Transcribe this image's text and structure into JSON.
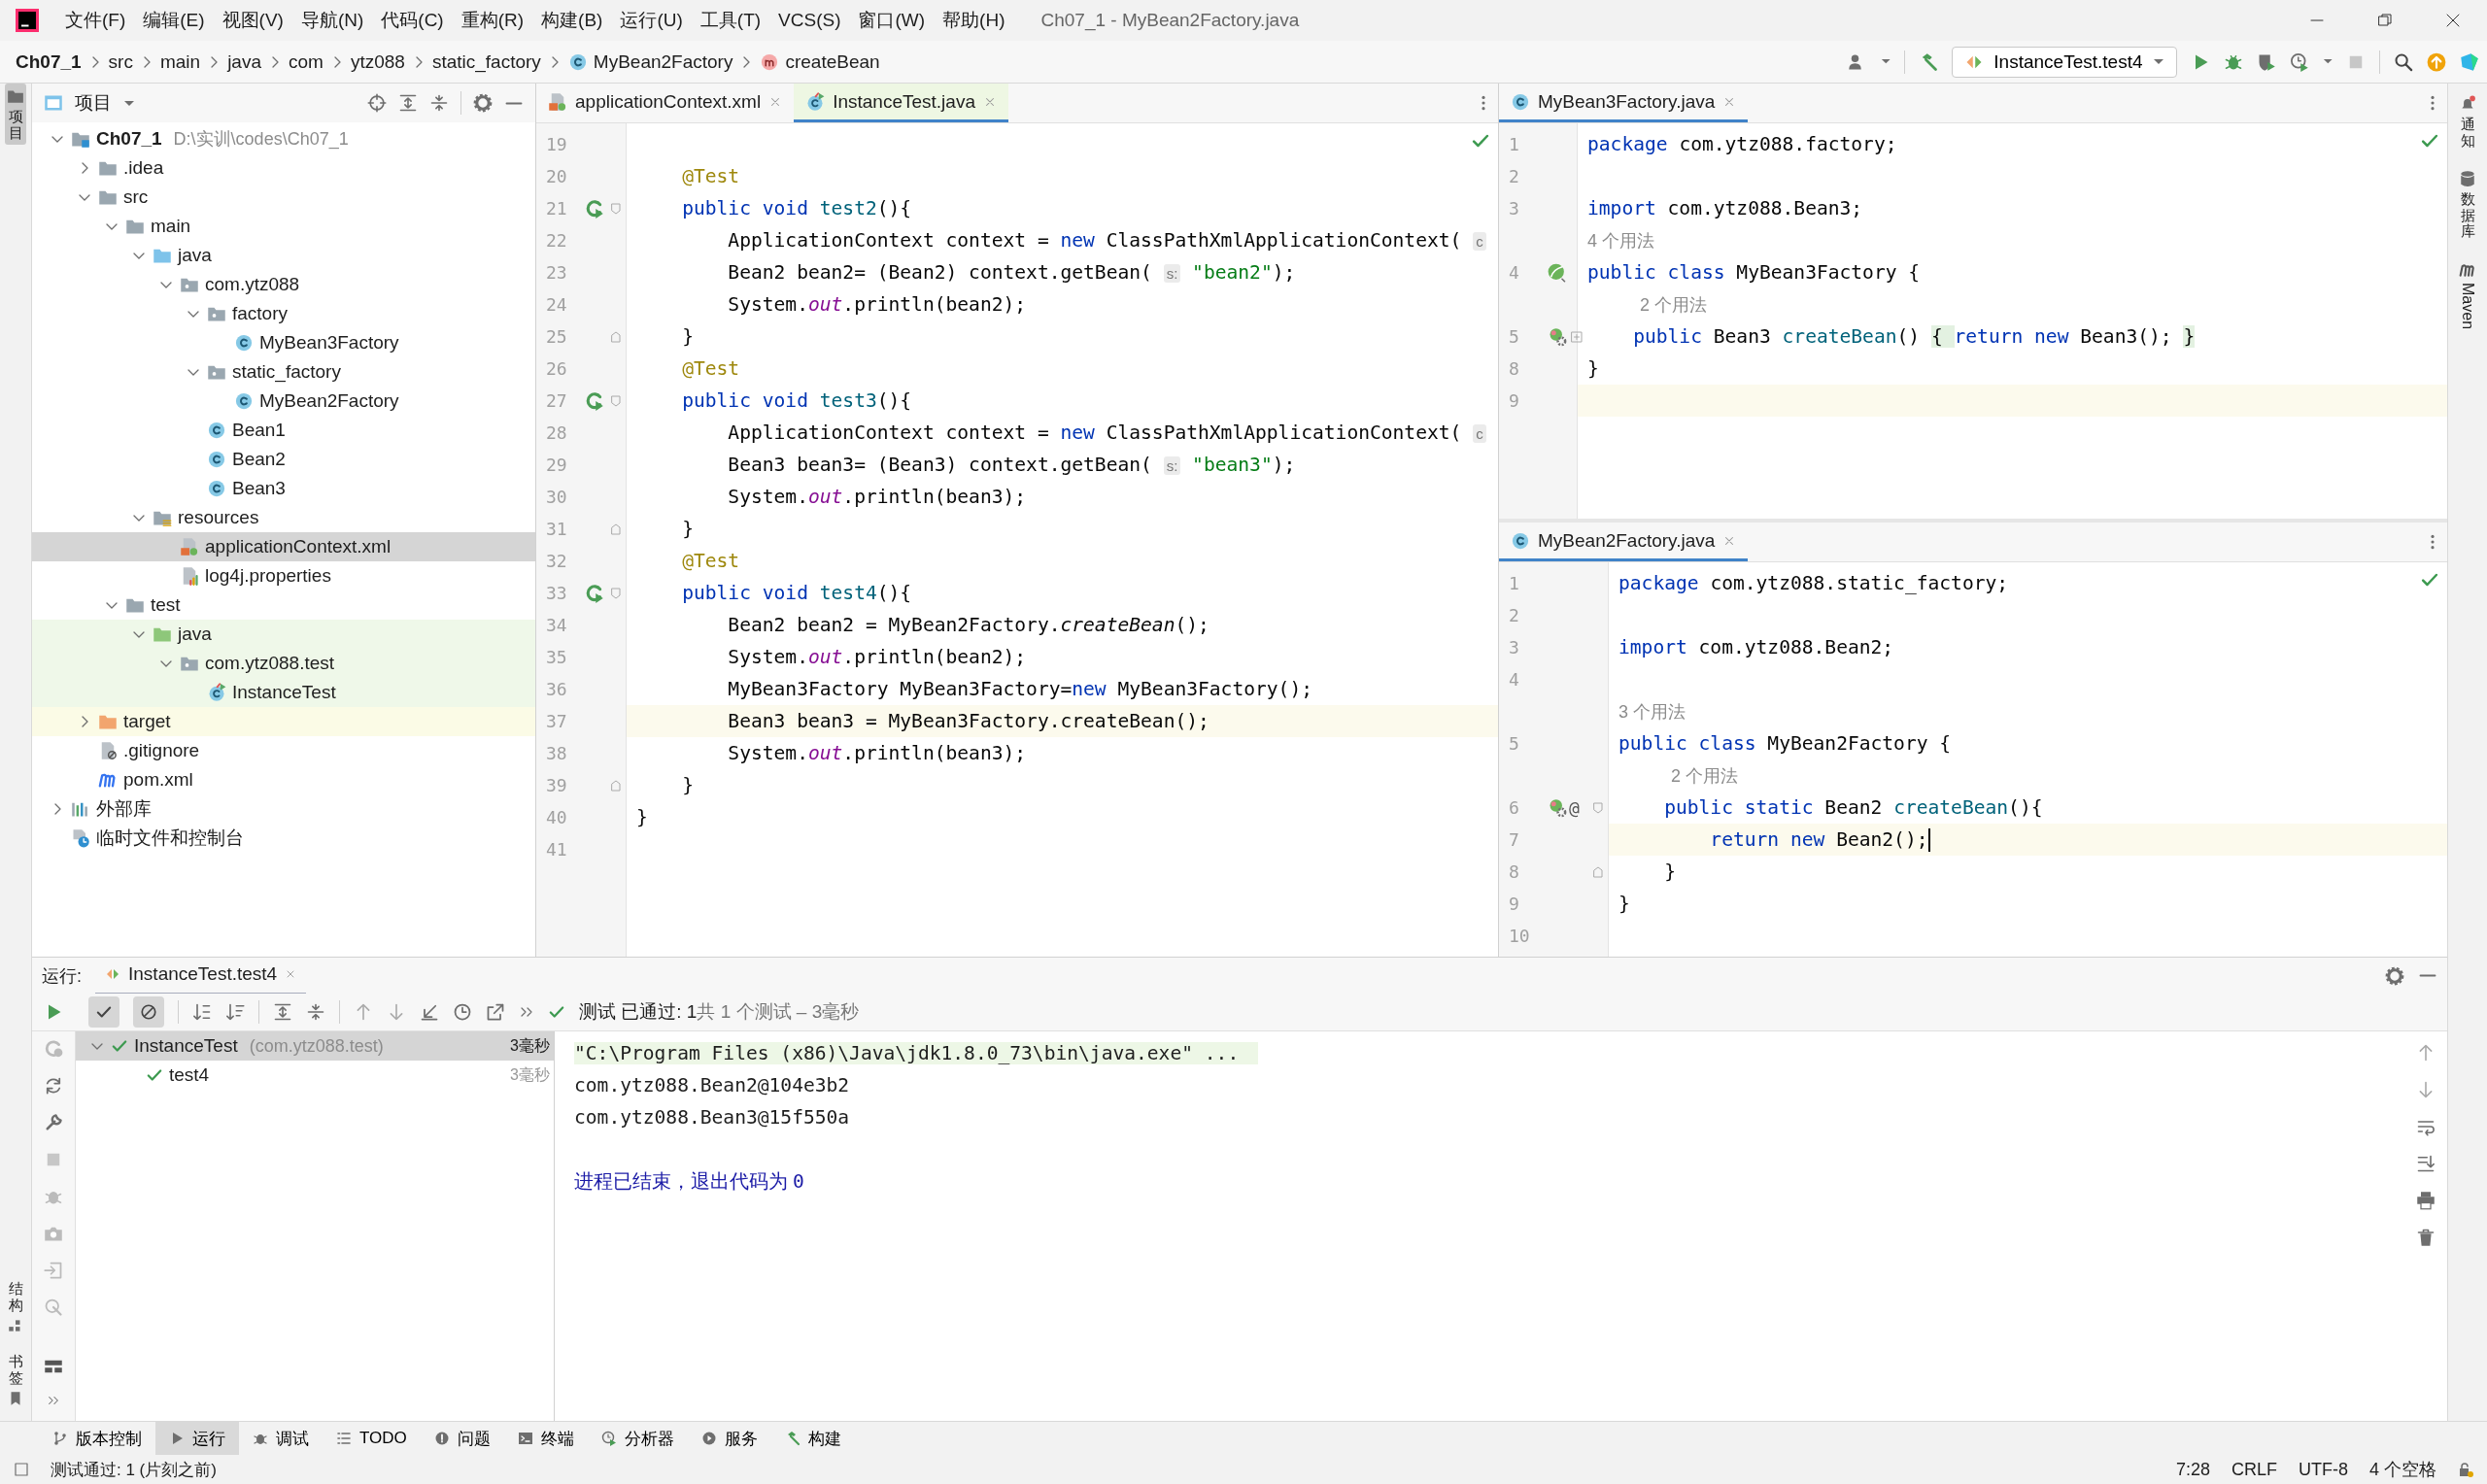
{
  "window": {
    "title": "Ch07_1 - MyBean2Factory.java"
  },
  "menu": [
    "文件(F)",
    "编辑(E)",
    "视图(V)",
    "导航(N)",
    "代码(C)",
    "重构(R)",
    "构建(B)",
    "运行(U)",
    "工具(T)",
    "VCS(S)",
    "窗口(W)",
    "帮助(H)"
  ],
  "breadcrumbs": [
    {
      "label": "Ch07_1",
      "kind": "project"
    },
    {
      "label": "src",
      "kind": "folder"
    },
    {
      "label": "main",
      "kind": "folder"
    },
    {
      "label": "java",
      "kind": "folder"
    },
    {
      "label": "com",
      "kind": "folder"
    },
    {
      "label": "ytz088",
      "kind": "folder"
    },
    {
      "label": "static_factory",
      "kind": "folder"
    },
    {
      "label": "MyBean2Factory",
      "kind": "class"
    },
    {
      "label": "createBean",
      "kind": "method"
    }
  ],
  "run_config": "InstanceTest.test4",
  "left_strip": {
    "top": [
      {
        "label": "项目",
        "selected": true
      }
    ],
    "bottom": [
      {
        "label": "结构",
        "selected": false
      },
      {
        "label": "书签",
        "selected": false
      }
    ]
  },
  "right_strip": [
    {
      "label": "通知",
      "kind": "notify"
    },
    {
      "label": "数据库",
      "kind": "database"
    },
    {
      "label": "Maven",
      "kind": "maven"
    }
  ],
  "project": {
    "title": "项目",
    "tree": [
      {
        "label": "Ch07_1",
        "hint": "D:\\实训\\codes\\Ch07_1",
        "kind": "project",
        "expanded": true,
        "selected": false,
        "children": [
          {
            "label": ".idea",
            "kind": "folder",
            "expanded": false,
            "selected": false
          },
          {
            "label": "src",
            "kind": "folder",
            "expanded": true,
            "selected": false,
            "children": [
              {
                "label": "main",
                "kind": "folder",
                "expanded": true,
                "selected": false,
                "children": [
                  {
                    "label": "java",
                    "kind": "source-root",
                    "expanded": true,
                    "selected": false,
                    "children": [
                      {
                        "label": "com.ytz088",
                        "kind": "package",
                        "expanded": true,
                        "selected": false,
                        "children": [
                          {
                            "label": "factory",
                            "kind": "package",
                            "expanded": true,
                            "selected": false,
                            "children": [
                              {
                                "label": "MyBean3Factory",
                                "kind": "class",
                                "selected": false
                              }
                            ]
                          },
                          {
                            "label": "static_factory",
                            "kind": "package",
                            "expanded": true,
                            "selected": false,
                            "children": [
                              {
                                "label": "MyBean2Factory",
                                "kind": "class",
                                "selected": false
                              }
                            ]
                          },
                          {
                            "label": "Bean1",
                            "kind": "class",
                            "selected": false
                          },
                          {
                            "label": "Bean2",
                            "kind": "class",
                            "selected": false
                          },
                          {
                            "label": "Bean3",
                            "kind": "class",
                            "selected": false
                          }
                        ]
                      }
                    ]
                  },
                  {
                    "label": "resources",
                    "kind": "resources-root",
                    "expanded": true,
                    "selected": false,
                    "children": [
                      {
                        "label": "applicationContext.xml",
                        "kind": "xml",
                        "selected": true
                      },
                      {
                        "label": "log4j.properties",
                        "kind": "properties",
                        "selected": false
                      }
                    ]
                  }
                ]
              },
              {
                "label": "test",
                "kind": "folder",
                "expanded": true,
                "selected": false,
                "children": [
                  {
                    "label": "java",
                    "kind": "test-root",
                    "test_source": true,
                    "expanded": true,
                    "selected": false,
                    "children": [
                      {
                        "label": "com.ytz088.test",
                        "kind": "package",
                        "test_source": true,
                        "expanded": true,
                        "selected": false,
                        "children": [
                          {
                            "label": "InstanceTest",
                            "kind": "test-class",
                            "test_source": true,
                            "selected": false
                          }
                        ]
                      }
                    ]
                  }
                ]
              }
            ]
          },
          {
            "label": "target",
            "kind": "excluded-folder",
            "excluded": true,
            "expanded": false,
            "selected": false
          },
          {
            "label": ".gitignore",
            "kind": "gitignore",
            "selected": false
          },
          {
            "label": "pom.xml",
            "kind": "maven",
            "selected": false
          }
        ]
      },
      {
        "label": "外部库",
        "kind": "libraries",
        "expanded": false,
        "selected": false
      },
      {
        "label": "临时文件和控制台",
        "kind": "scratches",
        "selected": false
      }
    ]
  },
  "editors": [
    {
      "tabs": [
        {
          "label": "applicationContext.xml",
          "kind": "xml",
          "selected": false
        },
        {
          "label": "InstanceTest.java",
          "kind": "test",
          "selected": true
        }
      ],
      "lines": [
        {
          "num": "19"
        },
        {
          "num": "20",
          "tokens": [
            {
              "kind": "ann",
              "text": "    @Test"
            }
          ]
        },
        {
          "num": "21",
          "gutter": [
            {
              "kind": "run"
            }
          ],
          "fold": {
            "kind": "start"
          },
          "tokens": [
            {
              "kind": "kw",
              "text": "    public void "
            },
            {
              "kind": "fn",
              "text": "test2"
            },
            {
              "kind": "plain",
              "text": "(){"
            }
          ]
        },
        {
          "num": "22",
          "tokens": [
            {
              "kind": "plain",
              "text": "        ApplicationContext context = "
            },
            {
              "kind": "kw",
              "text": "new "
            },
            {
              "kind": "plain",
              "text": "ClassPathXmlApplicationContext( "
            },
            {
              "kind": "hint",
              "text": "c"
            }
          ]
        },
        {
          "num": "23",
          "tokens": [
            {
              "kind": "plain",
              "text": "        Bean2 bean2= (Bean2) context.getBean( "
            },
            {
              "kind": "hint",
              "text": "s:"
            },
            {
              "kind": "str",
              "text": " \"bean2\""
            },
            {
              "kind": "plain",
              "text": ");"
            }
          ]
        },
        {
          "num": "24",
          "tokens": [
            {
              "kind": "plain",
              "text": "        System."
            },
            {
              "kind": "field",
              "text": "out"
            },
            {
              "kind": "plain",
              "text": ".println(bean2);"
            }
          ]
        },
        {
          "num": "25",
          "fold": {
            "kind": "end"
          },
          "tokens": [
            {
              "kind": "plain",
              "text": "    }"
            }
          ]
        },
        {
          "num": "26",
          "tokens": [
            {
              "kind": "ann",
              "text": "    @Test"
            }
          ]
        },
        {
          "num": "27",
          "gutter": [
            {
              "kind": "run"
            }
          ],
          "fold": {
            "kind": "start"
          },
          "tokens": [
            {
              "kind": "kw",
              "text": "    public void "
            },
            {
              "kind": "fn",
              "text": "test3"
            },
            {
              "kind": "plain",
              "text": "(){"
            }
          ]
        },
        {
          "num": "28",
          "tokens": [
            {
              "kind": "plain",
              "text": "        ApplicationContext context = "
            },
            {
              "kind": "kw",
              "text": "new "
            },
            {
              "kind": "plain",
              "text": "ClassPathXmlApplicationContext( "
            },
            {
              "kind": "hint",
              "text": "c"
            }
          ]
        },
        {
          "num": "29",
          "tokens": [
            {
              "kind": "plain",
              "text": "        Bean3 bean3= (Bean3) context.getBean( "
            },
            {
              "kind": "hint",
              "text": "s:"
            },
            {
              "kind": "str",
              "text": " \"bean3\""
            },
            {
              "kind": "plain",
              "text": ");"
            }
          ]
        },
        {
          "num": "30",
          "tokens": [
            {
              "kind": "plain",
              "text": "        System."
            },
            {
              "kind": "field",
              "text": "out"
            },
            {
              "kind": "plain",
              "text": ".println(bean3);"
            }
          ]
        },
        {
          "num": "31",
          "fold": {
            "kind": "end"
          },
          "tokens": [
            {
              "kind": "plain",
              "text": "    }"
            }
          ]
        },
        {
          "num": "32",
          "tokens": [
            {
              "kind": "ann",
              "text": "    @Test"
            }
          ]
        },
        {
          "num": "33",
          "gutter": [
            {
              "kind": "run"
            }
          ],
          "fold": {
            "kind": "start"
          },
          "tokens": [
            {
              "kind": "kw",
              "text": "    public void "
            },
            {
              "kind": "fn",
              "text": "test4"
            },
            {
              "kind": "plain",
              "text": "(){"
            }
          ]
        },
        {
          "num": "34",
          "tokens": [
            {
              "kind": "plain",
              "text": "        Bean2 bean2 = MyBean2Factory."
            },
            {
              "kind": "static",
              "text": "createBean"
            },
            {
              "kind": "plain",
              "text": "();"
            }
          ]
        },
        {
          "num": "35",
          "tokens": [
            {
              "kind": "plain",
              "text": "        System."
            },
            {
              "kind": "field",
              "text": "out"
            },
            {
              "kind": "plain",
              "text": ".println(bean2);"
            }
          ]
        },
        {
          "num": "36",
          "tokens": [
            {
              "kind": "plain",
              "text": "        MyBean3Factory MyBean3Factory="
            },
            {
              "kind": "kw",
              "text": "new "
            },
            {
              "kind": "plain",
              "text": "MyBean3Factory();"
            }
          ]
        },
        {
          "num": "37",
          "current": true,
          "tokens": [
            {
              "kind": "plain",
              "text": "        Bean3 bean3 = MyBean3Factory.createBean();"
            }
          ]
        },
        {
          "num": "38",
          "tokens": [
            {
              "kind": "plain",
              "text": "        System."
            },
            {
              "kind": "field",
              "text": "out"
            },
            {
              "kind": "plain",
              "text": ".println(bean3);"
            }
          ]
        },
        {
          "num": "39",
          "fold": {
            "kind": "end"
          },
          "tokens": [
            {
              "kind": "plain",
              "text": "    }"
            }
          ]
        },
        {
          "num": "40",
          "tokens": [
            {
              "kind": "plain",
              "text": "}"
            }
          ]
        },
        {
          "num": "41"
        }
      ]
    },
    {
      "tabs": [
        {
          "label": "MyBean3Factory.java",
          "kind": "class",
          "selected": true
        }
      ],
      "lines": [
        {
          "num": "1",
          "tokens": [
            {
              "kind": "kw",
              "text": "package "
            },
            {
              "kind": "plain",
              "text": "com.ytz088.factory;"
            }
          ]
        },
        {
          "num": "2"
        },
        {
          "num": "3",
          "tokens": [
            {
              "kind": "kw",
              "text": "import "
            },
            {
              "kind": "plain",
              "text": "com.ytz088.Bean3;"
            }
          ]
        },
        {
          "tokens": [
            {
              "kind": "usage",
              "text": "4 个用法"
            }
          ]
        },
        {
          "num": "4",
          "gutter": [
            {
              "kind": "bean"
            }
          ],
          "tokens": [
            {
              "kind": "kw",
              "text": "public class "
            },
            {
              "kind": "plain",
              "text": "MyBean3Factory {"
            }
          ]
        },
        {
          "tokens": [
            {
              "kind": "usage-indented",
              "text": "2 个用法"
            }
          ]
        },
        {
          "num": "5",
          "gutter": [
            {
              "kind": "bean-gear"
            }
          ],
          "fold": {
            "kind": "collapsed"
          },
          "tokens": [
            {
              "kind": "kw",
              "text": "    public "
            },
            {
              "kind": "plain",
              "text": "Bean3 "
            },
            {
              "kind": "fn",
              "text": "createBean"
            },
            {
              "kind": "plain",
              "text": "() "
            },
            {
              "kind": "fold",
              "text": "{ "
            },
            {
              "kind": "kw",
              "text": "return new "
            },
            {
              "kind": "plain",
              "text": "Bean3(); "
            },
            {
              "kind": "fold",
              "text": "}"
            }
          ]
        },
        {
          "num": "8",
          "tokens": [
            {
              "kind": "plain",
              "text": "}"
            }
          ]
        },
        {
          "num": "9",
          "current": true
        }
      ]
    },
    {
      "tabs": [
        {
          "label": "MyBean2Factory.java",
          "kind": "class",
          "selected": true
        }
      ],
      "lines": [
        {
          "num": "1",
          "tokens": [
            {
              "kind": "kw",
              "text": "package "
            },
            {
              "kind": "plain",
              "text": "com.ytz088.static_factory;"
            }
          ]
        },
        {
          "num": "2"
        },
        {
          "num": "3",
          "tokens": [
            {
              "kind": "kw",
              "text": "import "
            },
            {
              "kind": "plain",
              "text": "com.ytz088.Bean2;"
            }
          ]
        },
        {
          "num": "4"
        },
        {
          "tokens": [
            {
              "kind": "usage",
              "text": "3 个用法"
            }
          ]
        },
        {
          "num": "5",
          "tokens": [
            {
              "kind": "kw",
              "text": "public class "
            },
            {
              "kind": "plain",
              "text": "MyBean2Factory {"
            }
          ]
        },
        {
          "tokens": [
            {
              "kind": "usage-indented",
              "text": "2 个用法"
            }
          ]
        },
        {
          "num": "6",
          "gutter": [
            {
              "kind": "bean-gear"
            },
            {
              "kind": "text",
              "text": "@"
            }
          ],
          "fold": {
            "kind": "start"
          },
          "tokens": [
            {
              "kind": "kw",
              "text": "    public static "
            },
            {
              "kind": "plain",
              "text": "Bean2 "
            },
            {
              "kind": "fn",
              "text": "createBean"
            },
            {
              "kind": "plain",
              "text": "(){"
            }
          ]
        },
        {
          "num": "7",
          "current": true,
          "caret": true,
          "tokens": [
            {
              "kind": "kw",
              "text": "        return new "
            },
            {
              "kind": "plain",
              "text": "Bean2();"
            }
          ]
        },
        {
          "num": "8",
          "fold": {
            "kind": "end"
          },
          "tokens": [
            {
              "kind": "plain",
              "text": "    }"
            }
          ]
        },
        {
          "num": "9",
          "tokens": [
            {
              "kind": "plain",
              "text": "}"
            }
          ]
        },
        {
          "num": "10"
        }
      ]
    }
  ],
  "run_panel": {
    "label": "运行:",
    "tab": {
      "label": "InstanceTest.test4",
      "selected": true
    },
    "filters": [
      {
        "kind": "passed",
        "selected": true
      },
      {
        "kind": "ignored",
        "selected": true
      }
    ],
    "status": {
      "title": "测试 已通过: 1",
      "detail": "共 1 个测试 – 3毫秒"
    },
    "tests": [
      {
        "label": "InstanceTest",
        "hint": "(com.ytz088.test)",
        "time": "3毫秒",
        "passed": true,
        "expanded": true,
        "selected": true,
        "children": [
          {
            "label": "test4",
            "time": "3毫秒",
            "passed": true,
            "selected": false
          }
        ]
      }
    ],
    "console": [
      {
        "kind": "command",
        "text": "\"C:\\Program Files (x86)\\Java\\jdk1.8.0_73\\bin\\java.exe\" ..."
      },
      {
        "kind": "output",
        "text": "com.ytz088.Bean2@104e3b2"
      },
      {
        "kind": "output",
        "text": "com.ytz088.Bean3@15f550a"
      },
      {
        "kind": "blank"
      },
      {
        "kind": "exit",
        "text": "进程已结束，退出代码为 ",
        "code": "0"
      }
    ]
  },
  "tool_tabs": [
    {
      "label": "版本控制",
      "kind": "vcs",
      "selected": false
    },
    {
      "label": "运行",
      "kind": "run",
      "selected": true
    },
    {
      "label": "调试",
      "kind": "debug",
      "selected": false
    },
    {
      "label": "TODO",
      "kind": "todo",
      "selected": false
    },
    {
      "label": "问题",
      "kind": "problems",
      "selected": false
    },
    {
      "label": "终端",
      "kind": "terminal",
      "selected": false
    },
    {
      "label": "分析器",
      "kind": "profiler",
      "selected": false
    },
    {
      "label": "服务",
      "kind": "services",
      "selected": false
    },
    {
      "label": "构建",
      "kind": "build",
      "selected": false
    }
  ],
  "status_bar": {
    "message": "测试通过: 1 (片刻之前)",
    "items": [
      "7:28",
      "CRLF",
      "UTF-8",
      "4 个空格"
    ]
  }
}
